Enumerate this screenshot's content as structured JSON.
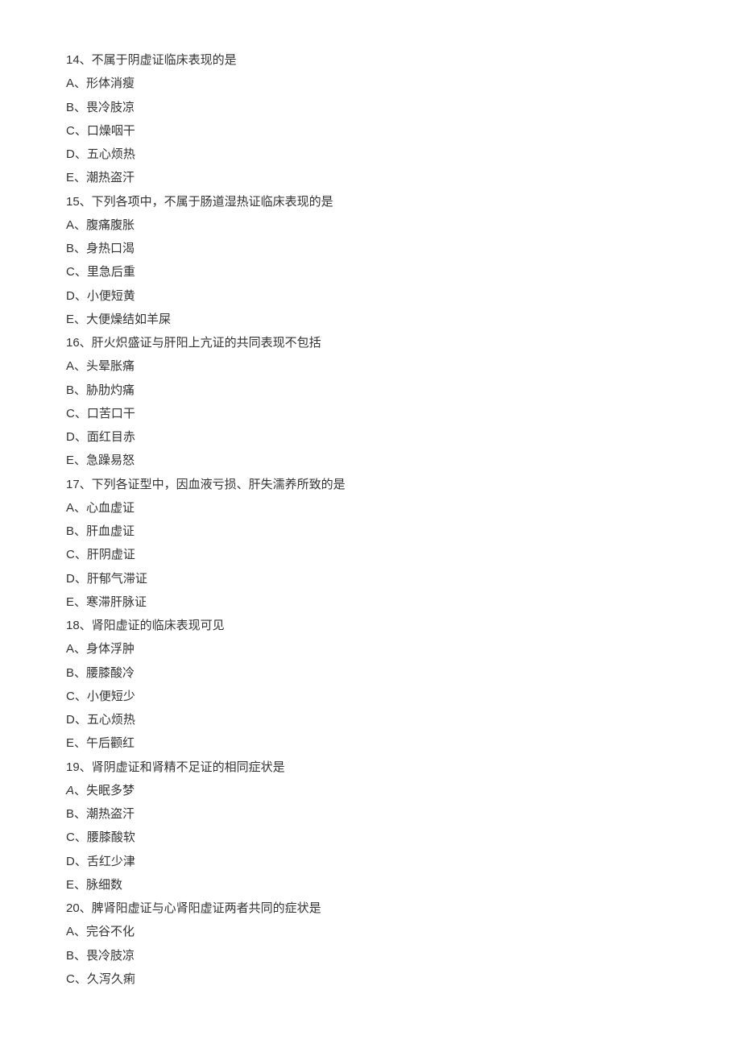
{
  "questions": [
    {
      "stem": "14、不属于阴虚证临床表现的是",
      "options": [
        "A、形体消瘦",
        "B、畏冷肢凉",
        "C、口燥咽干",
        "D、五心烦热",
        "E、潮热盗汗"
      ]
    },
    {
      "stem": "15、下列各项中，不属于肠道湿热证临床表现的是",
      "options": [
        "A、腹痛腹胀",
        "B、身热口渴",
        "C、里急后重",
        "D、小便短黄",
        "E、大便燥结如羊屎"
      ]
    },
    {
      "stem": "16、肝火炽盛证与肝阳上亢证的共同表现不包括",
      "options": [
        "A、头晕胀痛",
        "B、胁肋灼痛",
        "C、口苦口干",
        "D、面红目赤",
        "E、急躁易怒"
      ]
    },
    {
      "stem": "17、下列各证型中，因血液亏损、肝失濡养所致的是",
      "options": [
        "A、心血虚证",
        "B、肝血虚证",
        "C、肝阴虚证",
        "D、肝郁气滞证",
        "E、寒滞肝脉证"
      ]
    },
    {
      "stem": "18、肾阳虚证的临床表现可见",
      "options": [
        "A、身体浮肿",
        "B、腰膝酸冷",
        "C、小便短少",
        "D、五心烦热",
        "E、午后颧红"
      ]
    },
    {
      "stem": "19、肾阴虚证和肾精不足证的相同症状是",
      "options": [
        "A、失眠多梦",
        "B、潮热盗汗",
        "C、腰膝酸软",
        "D、舌红少津",
        "E、脉细数"
      ],
      "italicFirstOption": true
    },
    {
      "stem": "20、脾肾阳虚证与心肾阳虚证两者共同的症状是",
      "options": [
        "A、完谷不化",
        "B、畏冷肢凉",
        "C、久泻久痢"
      ]
    }
  ]
}
